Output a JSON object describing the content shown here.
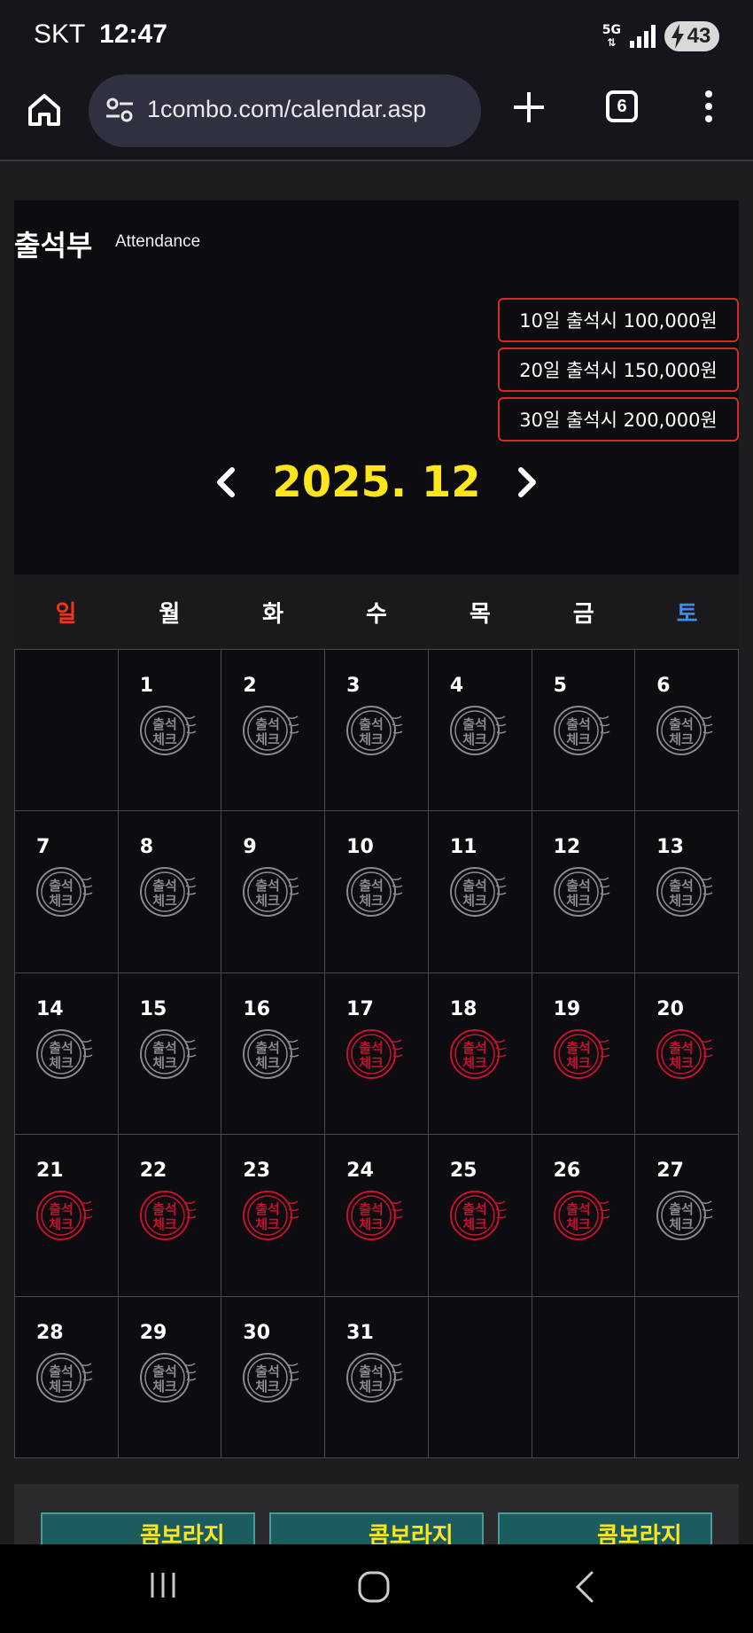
{
  "status_bar": {
    "carrier": "SKT",
    "time": "12:47",
    "network": "5G",
    "battery": "43"
  },
  "browser": {
    "url": "1combo.com/calendar.asp",
    "tab_count": "6"
  },
  "page": {
    "title": "출석부",
    "subtitle": "Attendance",
    "rewards": [
      "10일 출석시 100,000원",
      "20일 출석시 150,000원",
      "30일 출석시 200,000원"
    ],
    "month_label": "2025. 12",
    "weekdays": [
      "일",
      "월",
      "화",
      "수",
      "목",
      "금",
      "토"
    ],
    "stamp_text_top": "출석",
    "stamp_text_bottom": "체크",
    "calendar": {
      "leading_blank_days": 1,
      "days": [
        {
          "day": "1",
          "attended": false
        },
        {
          "day": "2",
          "attended": false
        },
        {
          "day": "3",
          "attended": false
        },
        {
          "day": "4",
          "attended": false
        },
        {
          "day": "5",
          "attended": false
        },
        {
          "day": "6",
          "attended": false
        },
        {
          "day": "7",
          "attended": false
        },
        {
          "day": "8",
          "attended": false
        },
        {
          "day": "9",
          "attended": false
        },
        {
          "day": "10",
          "attended": false
        },
        {
          "day": "11",
          "attended": false
        },
        {
          "day": "12",
          "attended": false
        },
        {
          "day": "13",
          "attended": false
        },
        {
          "day": "14",
          "attended": false
        },
        {
          "day": "15",
          "attended": false
        },
        {
          "day": "16",
          "attended": false
        },
        {
          "day": "17",
          "attended": true
        },
        {
          "day": "18",
          "attended": true
        },
        {
          "day": "19",
          "attended": true
        },
        {
          "day": "20",
          "attended": true
        },
        {
          "day": "21",
          "attended": true
        },
        {
          "day": "22",
          "attended": true
        },
        {
          "day": "23",
          "attended": true
        },
        {
          "day": "24",
          "attended": true
        },
        {
          "day": "25",
          "attended": true
        },
        {
          "day": "26",
          "attended": true
        },
        {
          "day": "27",
          "attended": false
        },
        {
          "day": "28",
          "attended": false
        },
        {
          "day": "29",
          "attended": false
        },
        {
          "day": "30",
          "attended": false
        },
        {
          "day": "31",
          "attended": false
        }
      ]
    },
    "banner_text": "콤보라지"
  },
  "colors": {
    "accent_yellow": "#ffe51c",
    "sunday_red": "#ee3322",
    "saturday_blue": "#3c8cf0",
    "stamp_attended": "#c8102e",
    "stamp_default": "#8a8a8e",
    "reward_border": "#d42a2a",
    "chat_blue": "#1f6fe8"
  },
  "icons": {
    "home": "home-icon",
    "site_settings": "tune-icon",
    "new_tab": "plus-icon",
    "tabs": "tab-switcher-icon",
    "menu": "more-vert-icon",
    "prev": "chevron-left-icon",
    "next": "chevron-right-icon",
    "chat": "chat-bubble-icon",
    "nav_recent": "recent-apps-icon",
    "nav_home": "home-circle-icon",
    "nav_back": "back-icon"
  }
}
